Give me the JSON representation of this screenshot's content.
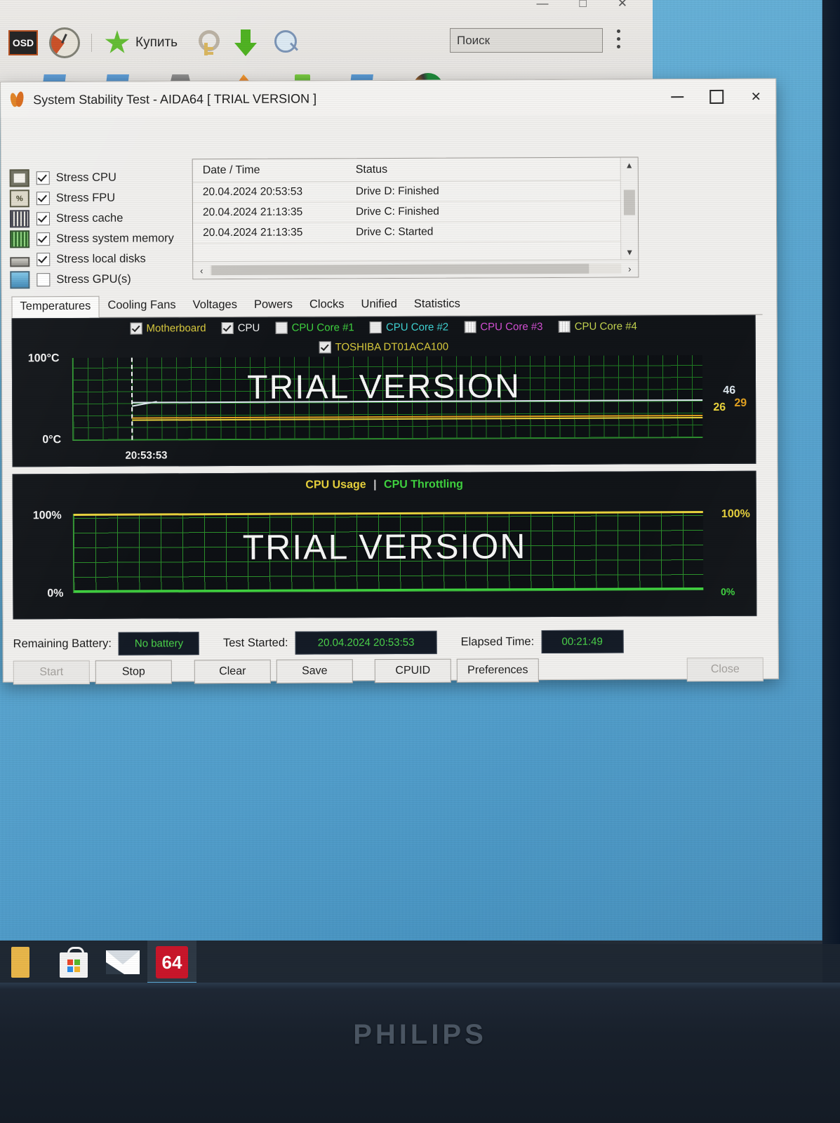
{
  "browser": {
    "toolbar": {
      "osd_badge": "OSD",
      "buy_label": "Купить",
      "icons": [
        "osd-icon",
        "gauge-icon",
        "star-icon",
        "key-icon",
        "download-arrow-icon",
        "magnifier-icon"
      ]
    },
    "search": {
      "placeholder": "Поиск",
      "value": "Поиск"
    },
    "menu_icon": "kebab-menu-icon",
    "window_controls": {
      "minimize": "—",
      "maximize": "□",
      "close": "✕"
    }
  },
  "aida": {
    "title": "System Stability Test - AIDA64  [ TRIAL VERSION ]",
    "window_controls": {
      "minimize": "—",
      "maximize": "□",
      "close": "✕"
    },
    "stress_options": [
      {
        "label": "Stress CPU",
        "checked": true,
        "icon": "cpu-icon"
      },
      {
        "label": "Stress FPU",
        "checked": true,
        "icon": "fpu-icon"
      },
      {
        "label": "Stress cache",
        "checked": true,
        "icon": "cache-icon"
      },
      {
        "label": "Stress system memory",
        "checked": true,
        "icon": "memory-icon"
      },
      {
        "label": "Stress local disks",
        "checked": true,
        "icon": "disk-icon"
      },
      {
        "label": "Stress GPU(s)",
        "checked": false,
        "icon": "gpu-icon"
      }
    ],
    "log": {
      "columns": [
        "Date / Time",
        "Status"
      ],
      "rows": [
        {
          "datetime": "20.04.2024 20:53:53",
          "status": "Drive D: Finished"
        },
        {
          "datetime": "20.04.2024 21:13:35",
          "status": "Drive C: Finished"
        },
        {
          "datetime": "20.04.2024 21:13:35",
          "status": "Drive C: Started"
        }
      ],
      "scroll_up": "▲",
      "scroll_down": "▼",
      "scroll_left": "‹",
      "scroll_right": "›"
    },
    "tabs": [
      {
        "label": "Temperatures",
        "active": true
      },
      {
        "label": "Cooling Fans",
        "active": false
      },
      {
        "label": "Voltages",
        "active": false
      },
      {
        "label": "Powers",
        "active": false
      },
      {
        "label": "Clocks",
        "active": false
      },
      {
        "label": "Unified",
        "active": false
      },
      {
        "label": "Statistics",
        "active": false
      }
    ],
    "watermark": "TRIAL VERSION",
    "status": {
      "battery_label": "Remaining Battery:",
      "battery_value": "No battery",
      "started_label": "Test Started:",
      "started_value": "20.04.2024 20:53:53",
      "elapsed_label": "Elapsed Time:",
      "elapsed_value": "00:21:49"
    },
    "buttons": [
      {
        "label": "Start",
        "disabled": true
      },
      {
        "label": "Stop",
        "disabled": false
      },
      {
        "label": "Clear",
        "disabled": false
      },
      {
        "label": "Save",
        "disabled": false
      },
      {
        "label": "CPUID",
        "disabled": false
      },
      {
        "label": "Preferences",
        "disabled": false
      },
      {
        "label": "Close",
        "disabled": true
      }
    ]
  },
  "chart_data": [
    {
      "type": "line",
      "title": "Temperatures",
      "ylabel": "",
      "ytick_top": "100°C",
      "ytick_bottom": "0°C",
      "ylim": [
        0,
        100
      ],
      "xlabel": "",
      "xtick_start": "20:53:53",
      "grid": true,
      "legend_position": "top",
      "legend": [
        {
          "name": "Motherboard",
          "color": "#d8c93c",
          "checked": true
        },
        {
          "name": "CPU",
          "color": "#f2f2f2",
          "checked": true
        },
        {
          "name": "CPU Core #1",
          "color": "#3fd23f",
          "checked": false
        },
        {
          "name": "CPU Core #2",
          "color": "#3fd2d2",
          "checked": false
        },
        {
          "name": "CPU Core #3",
          "color": "#d24fd2",
          "checked": false
        },
        {
          "name": "CPU Core #4",
          "color": "#c3d24f",
          "checked": false
        },
        {
          "name": "TOSHIBA DT01ACA100",
          "color": "#d8c93c",
          "checked": true
        }
      ],
      "series": [
        {
          "name": "CPU",
          "color": "#dfe8f0",
          "current_value": 46,
          "values": [
            29,
            44,
            45,
            46,
            46,
            46,
            46,
            46,
            46,
            46
          ]
        },
        {
          "name": "Motherboard",
          "color": "#e8d23c",
          "current_value": 26,
          "values": [
            24,
            25,
            26,
            26,
            26,
            26,
            26,
            26,
            26,
            26
          ]
        },
        {
          "name": "TOSHIBA DT01ACA100",
          "color": "#e0a020",
          "current_value": 29,
          "values": [
            27,
            28,
            29,
            29,
            29,
            29,
            29,
            29,
            29,
            29
          ]
        }
      ],
      "value_labels": [
        {
          "text": "46",
          "color": "#dfe8f0"
        },
        {
          "text": "26",
          "color": "#e8d23c"
        },
        {
          "text": "29",
          "color": "#e0a020"
        }
      ]
    },
    {
      "type": "line",
      "title": "CPU Usage  |  CPU Throttling",
      "title_parts": [
        {
          "text": "CPU Usage",
          "color": "#e8d23c"
        },
        {
          "text": "|",
          "color": "#cccccc"
        },
        {
          "text": "CPU Throttling",
          "color": "#3fd23f"
        }
      ],
      "ytick_top": "100%",
      "ytick_bottom": "0%",
      "ylim": [
        0,
        100
      ],
      "grid": true,
      "right_label_top": "100%",
      "right_label_bottom": "0%",
      "series": [
        {
          "name": "CPU Usage",
          "color": "#e8d23c",
          "current_value": 100,
          "values": [
            100,
            100,
            100,
            100,
            100,
            100,
            100,
            100,
            100,
            100
          ]
        },
        {
          "name": "CPU Throttling",
          "color": "#3fd23f",
          "current_value": 0,
          "values": [
            0,
            0,
            0,
            0,
            0,
            0,
            0,
            0,
            0,
            0
          ]
        }
      ]
    }
  ],
  "taskbar": {
    "items": [
      {
        "name": "edge-icon",
        "label": ""
      },
      {
        "name": "store-icon",
        "label": ""
      },
      {
        "name": "mail-icon",
        "label": ""
      },
      {
        "name": "aida64-icon",
        "label": "64",
        "active": true
      }
    ]
  },
  "monitor": {
    "brand": "PHILIPS"
  }
}
